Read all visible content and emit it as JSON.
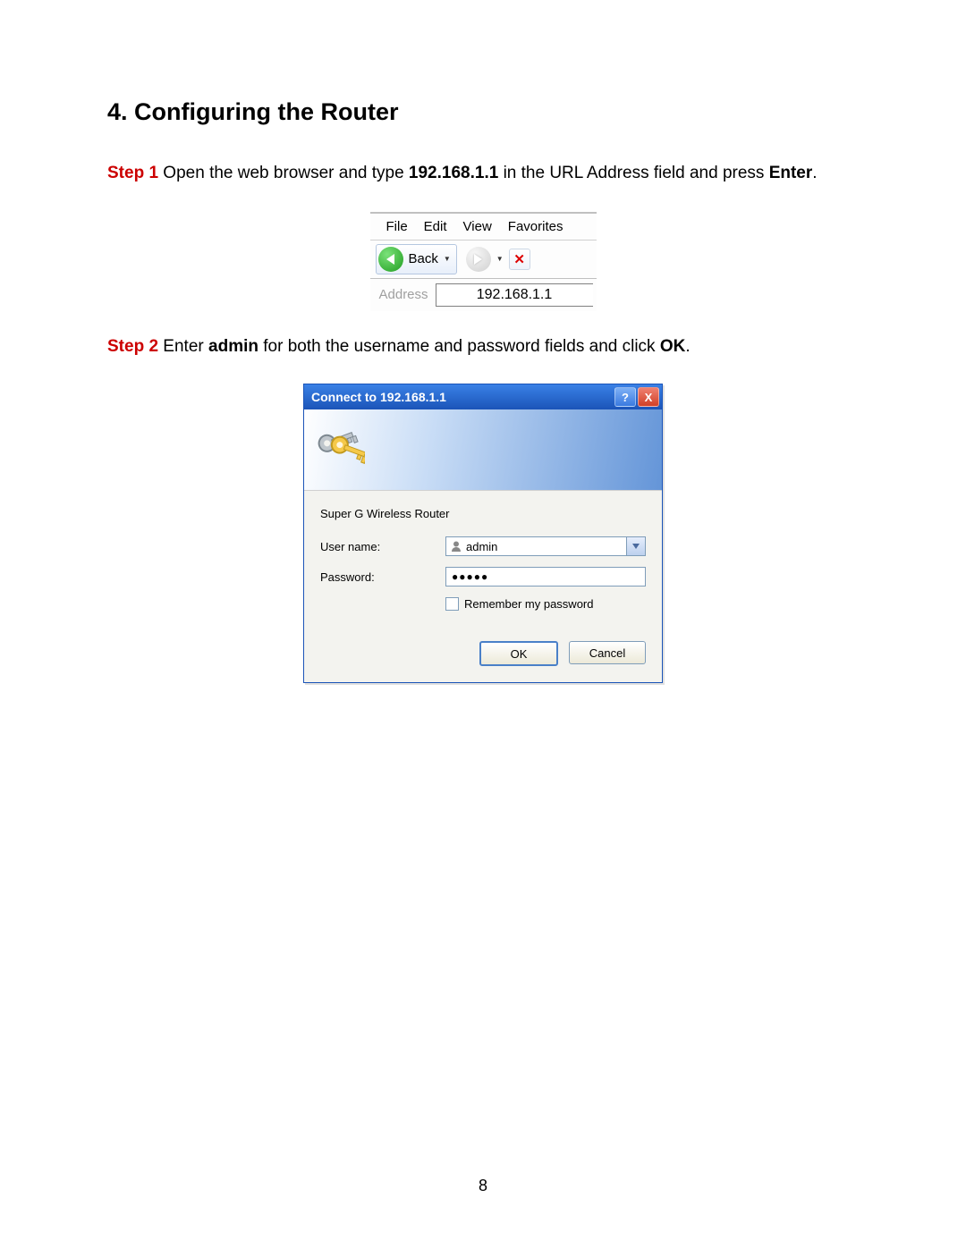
{
  "heading": "4. Configuring the Router",
  "step1": {
    "label": "Step 1",
    "text_a": " Open the web browser and type ",
    "ip": "192.168.1.1",
    "text_b": " in the URL Address field and press ",
    "enter": "Enter",
    "period": "."
  },
  "browser": {
    "menu": {
      "file": "File",
      "edit": "Edit",
      "view": "View",
      "favorites": "Favorites"
    },
    "back_label": "Back",
    "stop_glyph": "✕",
    "address_label": "Address",
    "address_value": "192.168.1.1"
  },
  "step2": {
    "label": "Step 2",
    "text_a": " Enter ",
    "admin": "admin",
    "text_b": " for both the username and password fields and click ",
    "ok": "OK",
    "period": "."
  },
  "dialog": {
    "title": "Connect to 192.168.1.1",
    "help_glyph": "?",
    "close_glyph": "X",
    "realm": "Super G Wireless Router",
    "username_label": "User name:",
    "username_value": "admin",
    "password_label": "Password:",
    "password_value": "●●●●●",
    "remember_label": "Remember my password",
    "ok_label": "OK",
    "cancel_label": "Cancel"
  },
  "page_number": "8"
}
